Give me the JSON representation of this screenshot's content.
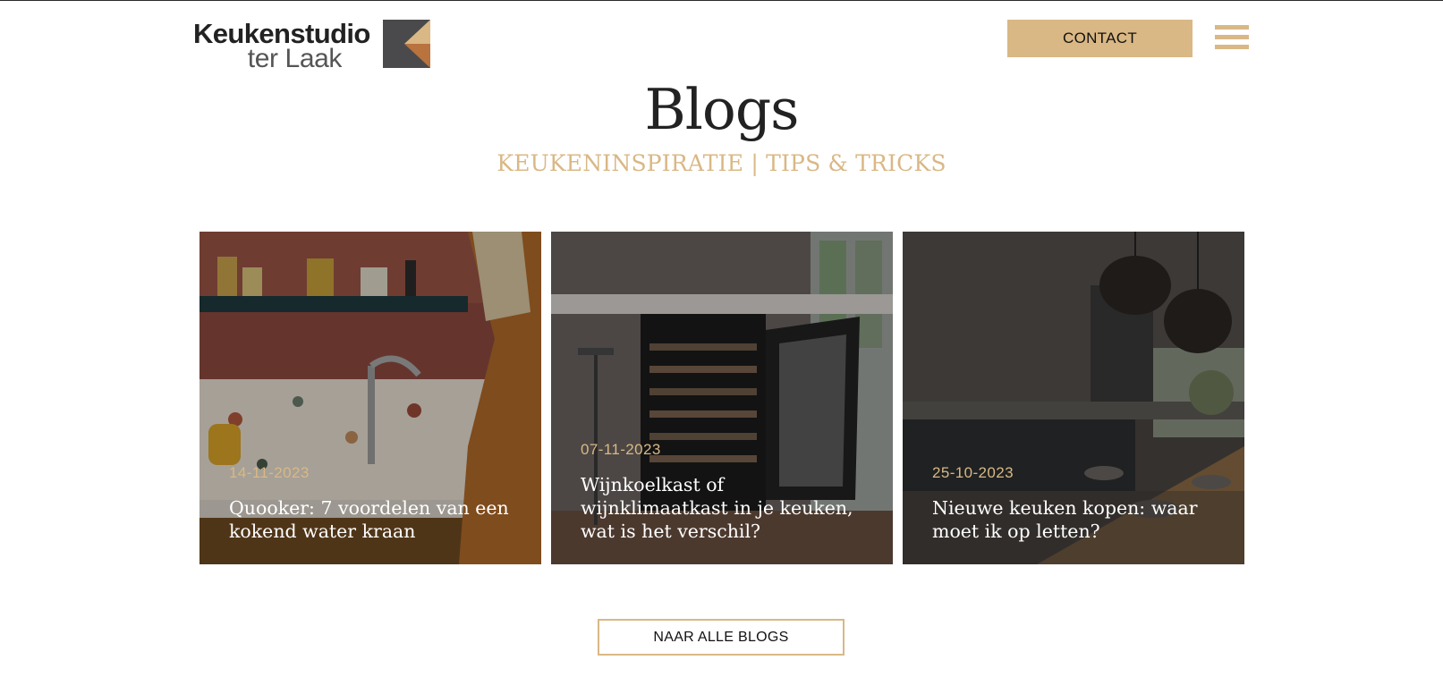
{
  "brand": {
    "line1": "Keukenstudio",
    "line2": "ter Laak",
    "accent_color": "#d9b885"
  },
  "header": {
    "contact_label": "CONTACT",
    "menu_icon": "hamburger-icon"
  },
  "section": {
    "title": "Blogs",
    "subtitle": "KEUKENINSPIRATIE | TIPS & TRICKS"
  },
  "blogs": [
    {
      "date": "14-11-2023",
      "title": "Quooker: 7 voordelen van een kokend water kraan"
    },
    {
      "date": "07-11-2023",
      "title": "Wijnkoelkast of wijnklimaatkast in je keuken, wat is het verschil?"
    },
    {
      "date": "25-10-2023",
      "title": "Nieuwe keuken kopen: waar moet ik op letten?"
    }
  ],
  "cta": {
    "all_blogs_label": "NAAR ALLE BLOGS"
  }
}
